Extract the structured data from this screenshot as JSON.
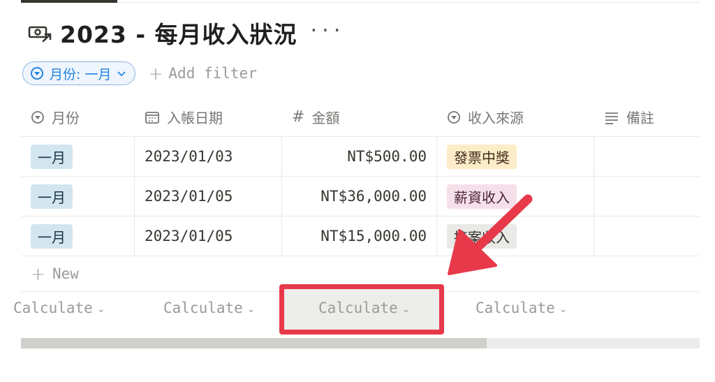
{
  "page": {
    "title": "2023 - 每月收入狀況",
    "title_icon": "money-arrow-icon",
    "more_label": "···"
  },
  "filter": {
    "label": "月份: 一月",
    "add_filter_label": "Add filter"
  },
  "table": {
    "columns": [
      {
        "label": "月份",
        "icon": "select-icon"
      },
      {
        "label": "入帳日期",
        "icon": "calendar-icon"
      },
      {
        "label": "金額",
        "icon": "number-icon"
      },
      {
        "label": "收入來源",
        "icon": "select-icon"
      },
      {
        "label": "備註",
        "icon": "text-lines-icon"
      }
    ],
    "rows": [
      {
        "month": "一月",
        "date": "2023/01/03",
        "amount": "NT$500.00",
        "source": "發票中獎",
        "note": ""
      },
      {
        "month": "一月",
        "date": "2023/01/05",
        "amount": "NT$36,000.00",
        "source": "薪資收入",
        "note": ""
      },
      {
        "month": "一月",
        "date": "2023/01/05",
        "amount": "NT$15,000.00",
        "source": "接案收入",
        "note": ""
      }
    ],
    "new_label": "New"
  },
  "calculate": {
    "labels": [
      "Calculate",
      "Calculate",
      "Calculate",
      "Calculate"
    ]
  },
  "colors": {
    "accent_blue": "#2383e2",
    "annotation_red": "#e8394a",
    "tag_month_bg": "#d3e5ef",
    "tag_prize_bg": "#fdecc8",
    "tag_salary_bg": "#f5e0e9",
    "tag_case_bg": "#e9e9e7"
  }
}
